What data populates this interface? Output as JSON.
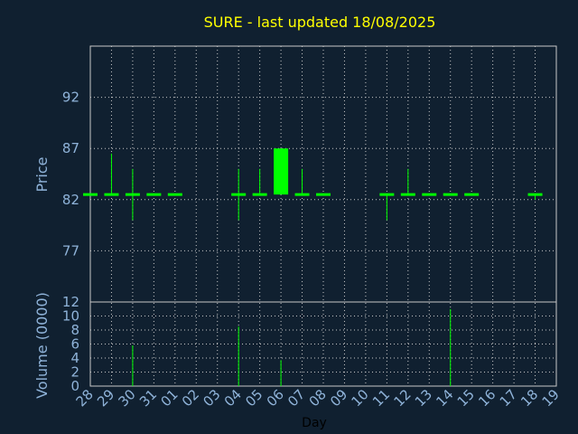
{
  "chart_data": {
    "type": "candlestick",
    "title": "SURE - last updated 18/08/2025",
    "xlabel": "Day",
    "colors": {
      "background": "#102030",
      "grid": "#c8c8c8",
      "axis": "#8fb3d9",
      "title": "#ffff00",
      "series": "#00ff00"
    },
    "x_tick_labels": [
      "28",
      "29",
      "30",
      "31",
      "01",
      "02",
      "03",
      "04",
      "05",
      "06",
      "07",
      "08",
      "09",
      "10",
      "11",
      "12",
      "13",
      "14",
      "15",
      "16",
      "17",
      "18",
      "19"
    ],
    "price_panel": {
      "ylabel": "Price",
      "ylim": [
        72,
        97
      ],
      "y_ticks": [
        77,
        82,
        87,
        92
      ],
      "grid": true,
      "candles": [
        {
          "x": "28",
          "open": 82.5,
          "close": 82.5,
          "high": 82.5,
          "low": 82.5
        },
        {
          "x": "29",
          "open": 82.5,
          "close": 82.5,
          "high": 86.5,
          "low": 82.5
        },
        {
          "x": "30",
          "open": 82.5,
          "close": 82.5,
          "high": 85.0,
          "low": 80.0
        },
        {
          "x": "31",
          "open": 82.5,
          "close": 82.5,
          "high": 82.5,
          "low": 82.5
        },
        {
          "x": "01",
          "open": 82.5,
          "close": 82.5,
          "high": 82.5,
          "low": 82.5
        },
        {
          "x": "04",
          "open": 82.5,
          "close": 82.5,
          "high": 85.0,
          "low": 80.0
        },
        {
          "x": "05",
          "open": 82.5,
          "close": 82.5,
          "high": 85.0,
          "low": 82.5
        },
        {
          "x": "06",
          "open": 82.5,
          "close": 87.0,
          "high": 87.0,
          "low": 82.5
        },
        {
          "x": "07",
          "open": 82.5,
          "close": 82.5,
          "high": 85.0,
          "low": 82.5
        },
        {
          "x": "08",
          "open": 82.5,
          "close": 82.5,
          "high": 82.5,
          "low": 82.5
        },
        {
          "x": "11",
          "open": 82.5,
          "close": 82.5,
          "high": 82.5,
          "low": 80.0
        },
        {
          "x": "12",
          "open": 82.5,
          "close": 82.5,
          "high": 85.0,
          "low": 82.5
        },
        {
          "x": "13",
          "open": 82.5,
          "close": 82.5,
          "high": 82.5,
          "low": 82.5
        },
        {
          "x": "14",
          "open": 82.5,
          "close": 82.5,
          "high": 82.5,
          "low": 82.5
        },
        {
          "x": "15",
          "open": 82.5,
          "close": 82.5,
          "high": 82.5,
          "low": 82.5
        },
        {
          "x": "18",
          "open": 82.5,
          "close": 82.5,
          "high": 82.5,
          "low": 82.0
        }
      ]
    },
    "volume_panel": {
      "ylabel": "Volume (0000)",
      "ylim": [
        0,
        12
      ],
      "y_ticks": [
        0,
        2,
        4,
        6,
        8,
        10,
        12
      ],
      "grid": true,
      "bars": [
        {
          "x": "30",
          "value": 5.8
        },
        {
          "x": "04",
          "value": 8.5
        },
        {
          "x": "06",
          "value": 3.7
        },
        {
          "x": "14",
          "value": 11.0
        }
      ]
    }
  }
}
